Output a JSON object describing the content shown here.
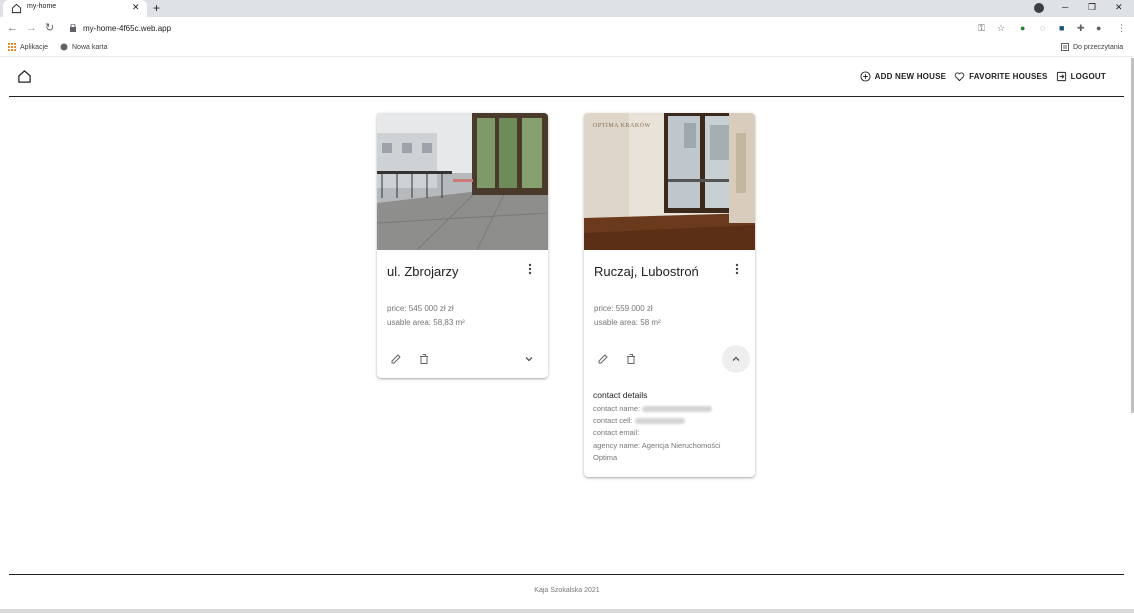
{
  "browser": {
    "tab_title": "my-home",
    "url": "my-home-4f65c.web.app",
    "bookmarks": {
      "apps": "Aplikacje",
      "new_tab": "Nowa karta",
      "reading_list": "Do przeczytania"
    }
  },
  "header": {
    "nav": {
      "add": "ADD NEW HOUSE",
      "favorites": "FAVORITE HOUSES",
      "logout": "LOGOUT"
    }
  },
  "houses": [
    {
      "title": "ul. Zbrojarzy",
      "price": "price: 545 000 zł zł",
      "area": "usable area: 58,83 m²",
      "expanded": false
    },
    {
      "title": "Ruczaj, Lubostroń",
      "price": "price: 559 000 zł",
      "area": "usable area: 58 m²",
      "expanded": true,
      "watermark": "OPTIMA KRAKÓW",
      "contact": {
        "heading": "contact details",
        "name_label": "contact name:",
        "cell_label": "contact cell:",
        "email_label": "contact email:",
        "agency": "agency name: Agencja Nieruchomości Optima"
      }
    }
  ],
  "footer": {
    "text": "Kaja Szokalska 2021"
  },
  "colors": {
    "text": "#222222",
    "muted": "#777777",
    "chrome": "#dee1e6"
  }
}
